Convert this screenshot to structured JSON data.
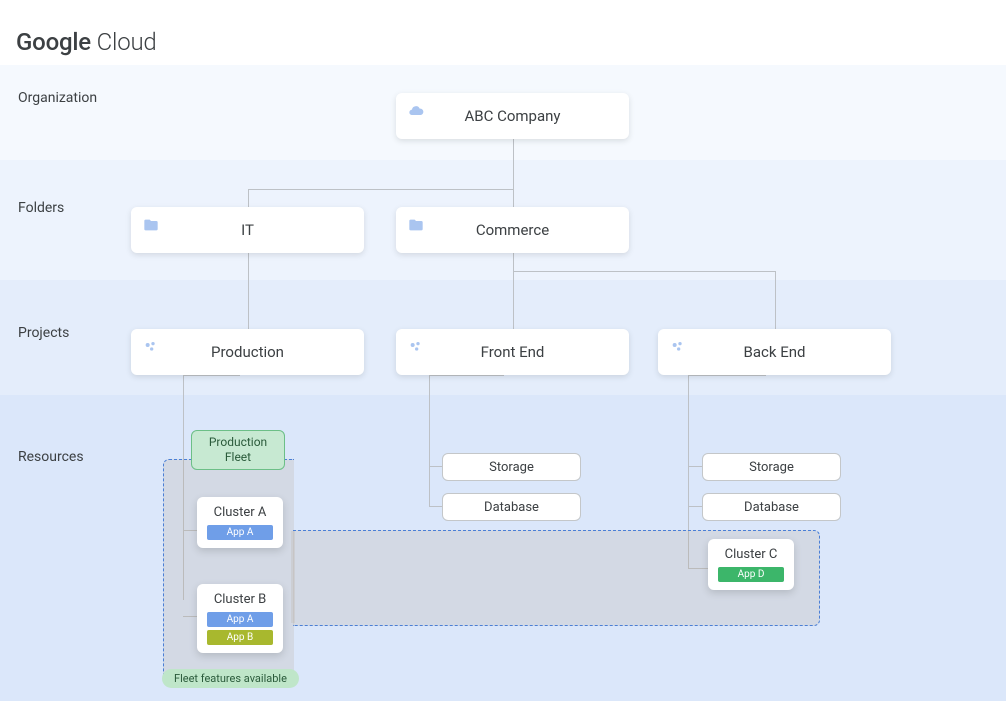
{
  "brand": {
    "bold": "Google",
    "thin": " Cloud"
  },
  "rows": {
    "organization": "Organization",
    "folders": "Folders",
    "projects": "Projects",
    "resources": "Resources"
  },
  "org": {
    "name": "ABC Company"
  },
  "folders": {
    "it": "IT",
    "commerce": "Commerce"
  },
  "projects": {
    "production": "Production",
    "frontend": "Front End",
    "backend": "Back End"
  },
  "resources": {
    "fleet_label": "Production\nFleet",
    "cluster_a": {
      "title": "Cluster A",
      "apps": [
        "App A"
      ]
    },
    "cluster_b": {
      "title": "Cluster B",
      "apps": [
        "App A",
        "App B"
      ]
    },
    "cluster_c": {
      "title": "Cluster C",
      "apps": [
        "App D"
      ]
    },
    "storage": "Storage",
    "database": "Database"
  },
  "footer": "Fleet features available",
  "colors": {
    "app_a": "#6f9ee8",
    "app_b": "#a8b82e",
    "app_d": "#3cb66a",
    "fleet_fill": "rgba(180,170,150,0.22)",
    "fleet_border": "#4a7fd6"
  }
}
